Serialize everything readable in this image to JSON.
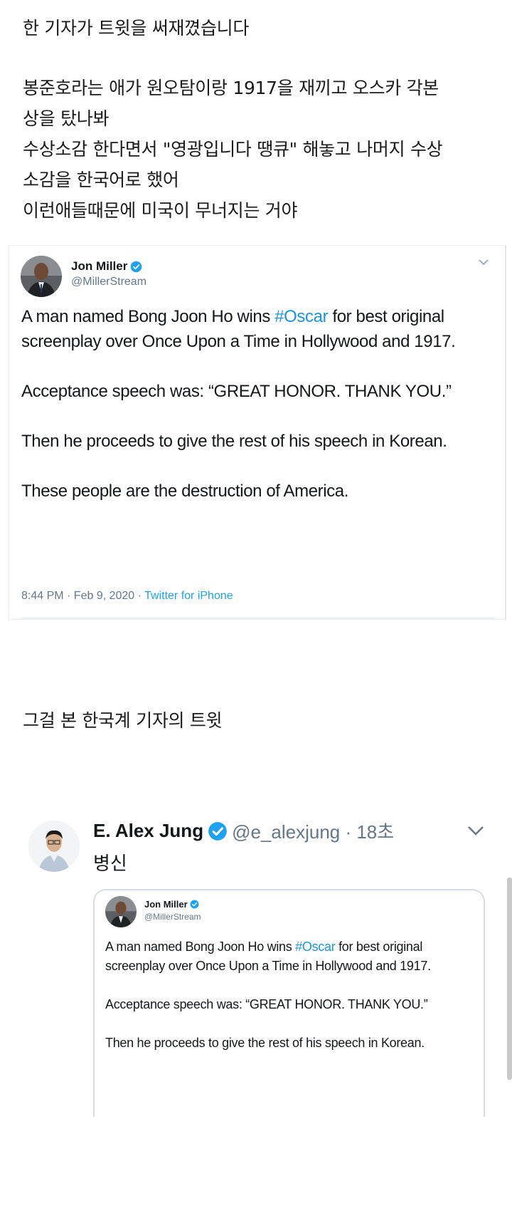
{
  "post": {
    "intro": "한 기자가 트윗을 써재꼈습니다",
    "story_lines": [
      "봉준호라는 애가 원오탐이랑 1917을 재끼고 오스카 각본",
      "상을 탔나봐",
      "수상소감 한다면서 \"영광입니다 땡큐\" 해놓고 나머지 수상",
      "소감을 한국어로 했어",
      "이런애들때문에 미국이 무너지는 거야"
    ],
    "caption": "그걸 본 한국계 기자의 트윗"
  },
  "tweet_original": {
    "name": "Jon Miller",
    "handle": "@MillerStream",
    "para1_before": "A man named Bong Joon Ho wins ",
    "hashtag": "#Oscar",
    "para1_after": " for best original screenplay over Once Upon a Time in Hollywood and 1917.",
    "para2": "Acceptance speech was: “GREAT HONOR. THANK YOU.”",
    "para3": "Then he proceeds to give the rest of his speech in Korean.",
    "para4": "These people are the destruction of America.",
    "timestamp": "8:44 PM · Feb 9, 2020 · ",
    "source": "Twitter for iPhone"
  },
  "tweet_reply": {
    "name": "E. Alex Jung",
    "handle": "@e_alexjung · 18초",
    "text": "병신"
  },
  "colors": {
    "link": "#1b95e0",
    "verified": "#1da1f2",
    "secondary": "#657786"
  },
  "icons": [
    "verified-badge-icon",
    "chevron-down-icon",
    "avatar-icon"
  ]
}
